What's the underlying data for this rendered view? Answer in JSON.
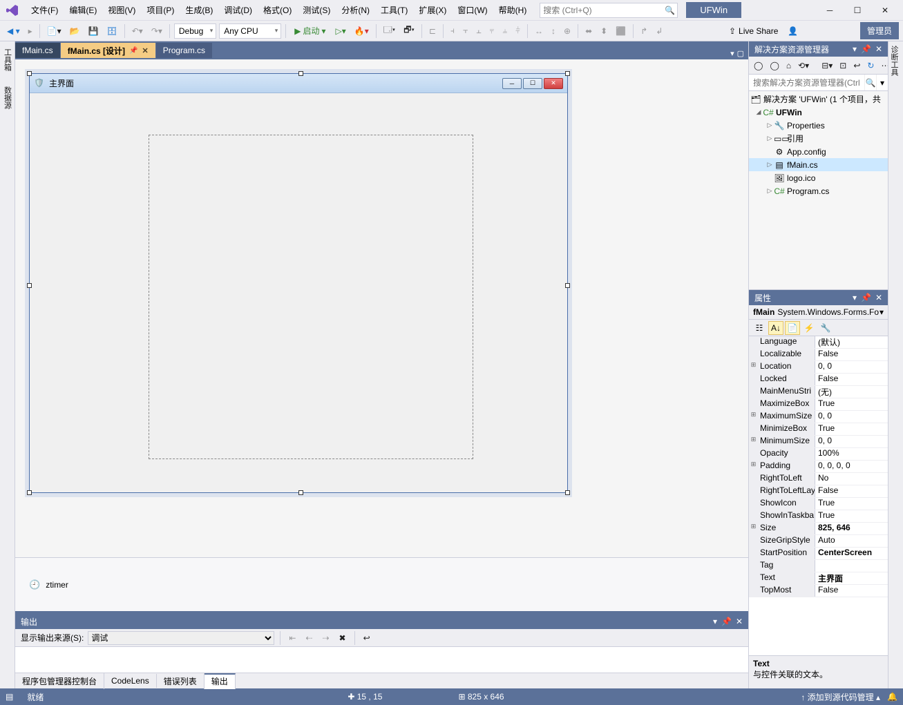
{
  "title_project": "UFWin",
  "search_placeholder": "搜索 (Ctrl+Q)",
  "menu": [
    "文件(F)",
    "编辑(E)",
    "视图(V)",
    "项目(P)",
    "生成(B)",
    "调试(D)",
    "格式(O)",
    "测试(S)",
    "分析(N)",
    "工具(T)",
    "扩展(X)",
    "窗口(W)",
    "帮助(H)"
  ],
  "toolbar": {
    "config": "Debug",
    "platform": "Any CPU",
    "start_label": "启动",
    "live_share": "Live Share",
    "admin": "管理员"
  },
  "left_rail": [
    "工具箱",
    "数据源"
  ],
  "right_rail": [
    "诊断工具"
  ],
  "tabs": {
    "t0": "fMain.cs",
    "t1": "fMain.cs [设计]",
    "t2": "Program.cs"
  },
  "designer": {
    "form_title": "主界面",
    "tray_component": "ztimer"
  },
  "output": {
    "panel_title": "输出",
    "source_label": "显示输出来源(S):",
    "source_value": "调试",
    "bottom_tabs": [
      "程序包管理器控制台",
      "CodeLens",
      "错误列表",
      "输出"
    ]
  },
  "solution": {
    "title": "解决方案资源管理器",
    "search_placeholder": "搜索解决方案资源管理器(Ctrl+;)",
    "root": "解决方案 'UFWin' (1 个项目，共",
    "project": "UFWin",
    "nodes": {
      "properties": "Properties",
      "references": "引用",
      "appconfig": "App.config",
      "fmain": "fMain.cs",
      "logo": "logo.ico",
      "program": "Program.cs"
    }
  },
  "properties": {
    "panel_title": "属性",
    "target_name": "fMain",
    "target_type": "System.Windows.Forms.Fo",
    "rows": [
      {
        "exp": "",
        "name": "Language",
        "value": "(默认)",
        "bold": false
      },
      {
        "exp": "",
        "name": "Localizable",
        "value": "False",
        "bold": false
      },
      {
        "exp": "⊞",
        "name": "Location",
        "value": "0, 0",
        "bold": false
      },
      {
        "exp": "",
        "name": "Locked",
        "value": "False",
        "bold": false
      },
      {
        "exp": "",
        "name": "MainMenuStri",
        "value": "(无)",
        "bold": false
      },
      {
        "exp": "",
        "name": "MaximizeBox",
        "value": "True",
        "bold": false
      },
      {
        "exp": "⊞",
        "name": "MaximumSize",
        "value": "0, 0",
        "bold": false
      },
      {
        "exp": "",
        "name": "MinimizeBox",
        "value": "True",
        "bold": false
      },
      {
        "exp": "⊞",
        "name": "MinimumSize",
        "value": "0, 0",
        "bold": false
      },
      {
        "exp": "",
        "name": "Opacity",
        "value": "100%",
        "bold": false
      },
      {
        "exp": "⊞",
        "name": "Padding",
        "value": "0, 0, 0, 0",
        "bold": false
      },
      {
        "exp": "",
        "name": "RightToLeft",
        "value": "No",
        "bold": false
      },
      {
        "exp": "",
        "name": "RightToLeftLay",
        "value": "False",
        "bold": false
      },
      {
        "exp": "",
        "name": "ShowIcon",
        "value": "True",
        "bold": false
      },
      {
        "exp": "",
        "name": "ShowInTaskba",
        "value": "True",
        "bold": false
      },
      {
        "exp": "⊞",
        "name": "Size",
        "value": "825, 646",
        "bold": true
      },
      {
        "exp": "",
        "name": "SizeGripStyle",
        "value": "Auto",
        "bold": false
      },
      {
        "exp": "",
        "name": "StartPosition",
        "value": "CenterScreen",
        "bold": true
      },
      {
        "exp": "",
        "name": "Tag",
        "value": "",
        "bold": false
      },
      {
        "exp": "",
        "name": "Text",
        "value": "主界面",
        "bold": true
      },
      {
        "exp": "",
        "name": "TopMost",
        "value": "False",
        "bold": false
      }
    ],
    "desc_name": "Text",
    "desc_text": "与控件关联的文本。"
  },
  "statusbar": {
    "ready": "就绪",
    "pos": "15 , 15",
    "size": "825 x 646",
    "source_control": "添加到源代码管理"
  }
}
